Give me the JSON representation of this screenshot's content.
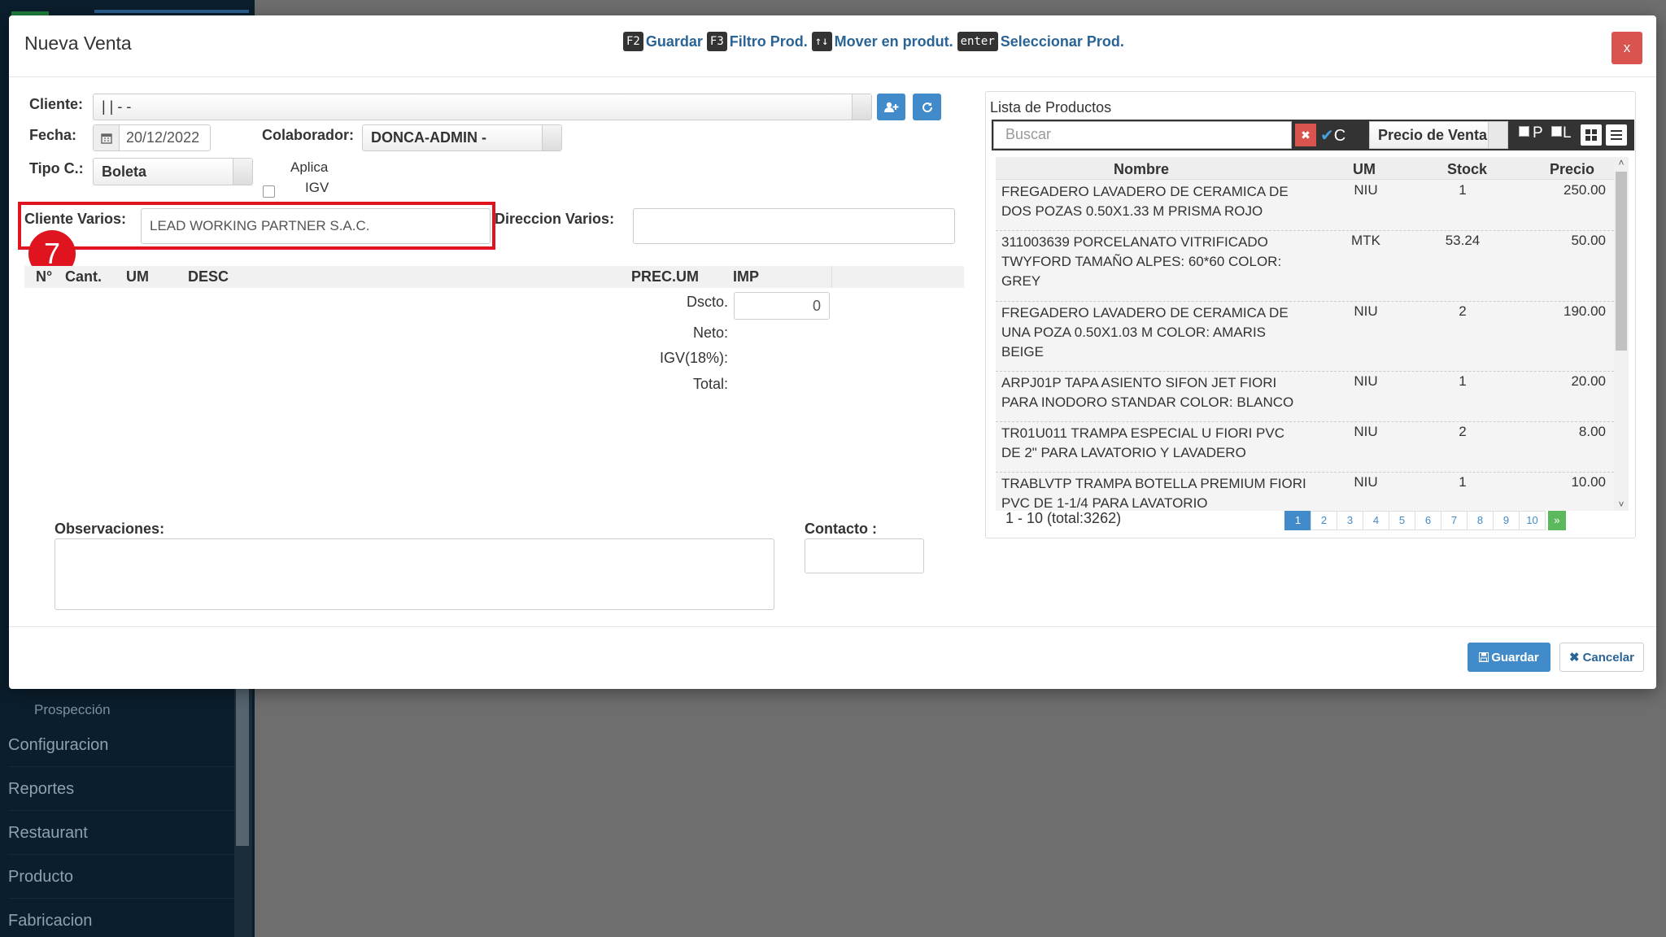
{
  "background": {
    "sidebar_items": [
      "Prospección",
      "Configuracion",
      "Reportes",
      "Restaurant",
      "Producto",
      "Fabricacion"
    ]
  },
  "modal": {
    "title": "Nueva Venta",
    "close_label": "x",
    "shortcuts": [
      {
        "key": "F2",
        "label": "Guardar"
      },
      {
        "key": "F3",
        "label": "Filtro Prod."
      },
      {
        "key": "↑↓",
        "label": "Mover en produt."
      },
      {
        "key": "enter",
        "label": "Seleccionar Prod."
      }
    ]
  },
  "form": {
    "cliente_label": "Cliente:",
    "cliente_value": "| | - -",
    "fecha_label": "Fecha:",
    "fecha_value": "20/12/2022",
    "colaborador_label": "Colaborador:",
    "colaborador_value": "DONCA-ADMIN -",
    "tipo_label": "Tipo C.:",
    "tipo_value": "Boleta",
    "aplica_label": "Aplica",
    "igv_label": "IGV",
    "cliente_varios_label": "Cliente Varios:",
    "cliente_varios_value": "LEAD WORKING PARTNER S.A.C.",
    "direccion_label": "Direccion Varios:",
    "direccion_value": "",
    "step_badge": "7"
  },
  "detail_table": {
    "columns": [
      "N°",
      "Cant.",
      "UM",
      "DESC",
      "PREC.UM",
      "IMP"
    ],
    "dscto_label": "Dscto.",
    "dscto_value": "0",
    "neto_label": "Neto:",
    "igv_label": "IGV(18%):",
    "total_label": "Total:"
  },
  "observaciones_label": "Observaciones:",
  "contacto_label": "Contacto :",
  "product_list": {
    "title": "Lista de Productos",
    "search_placeholder": "Buscar",
    "clear_label": "✖",
    "c_label": "C",
    "price_select": "Precio de Venta",
    "p_label": "P",
    "l_label": "L",
    "columns": [
      "Nombre",
      "UM",
      "Stock",
      "Precio"
    ],
    "rows": [
      {
        "nombre": "FREGADERO LAVADERO DE CERAMICA DE DOS POZAS 0.50X1.33 M PRISMA ROJO",
        "um": "NIU",
        "stock": "1",
        "precio": "250.00"
      },
      {
        "nombre": "311003639 PORCELANATO VITRIFICADO TWYFORD TAMAÑO ALPES: 60*60 COLOR: GREY",
        "um": "MTK",
        "stock": "53.24",
        "precio": "50.00"
      },
      {
        "nombre": "FREGADERO LAVADERO DE CERAMICA DE UNA POZA 0.50X1.03 M COLOR: AMARIS BEIGE",
        "um": "NIU",
        "stock": "2",
        "precio": "190.00"
      },
      {
        "nombre": "ARPJ01P TAPA ASIENTO SIFON JET FIORI PARA INODORO STANDAR COLOR: BLANCO",
        "um": "NIU",
        "stock": "1",
        "precio": "20.00"
      },
      {
        "nombre": "TR01U011 TRAMPA ESPECIAL U FIORI PVC DE 2\" PARA LAVATORIO Y LAVADERO",
        "um": "NIU",
        "stock": "2",
        "precio": "8.00"
      },
      {
        "nombre": "TRABLVTP TRAMPA BOTELLA PREMIUM FIORI PVC DE 1-1/4 PARA LAVATORIO",
        "um": "NIU",
        "stock": "1",
        "precio": "10.00"
      }
    ],
    "pagination_info": "1 - 10 (total:3262)",
    "pages": [
      "1",
      "2",
      "3",
      "4",
      "5",
      "6",
      "7",
      "8",
      "9",
      "10"
    ],
    "next_label": "»"
  },
  "footer": {
    "save_label": "Guardar",
    "cancel_label": "Cancelar"
  }
}
